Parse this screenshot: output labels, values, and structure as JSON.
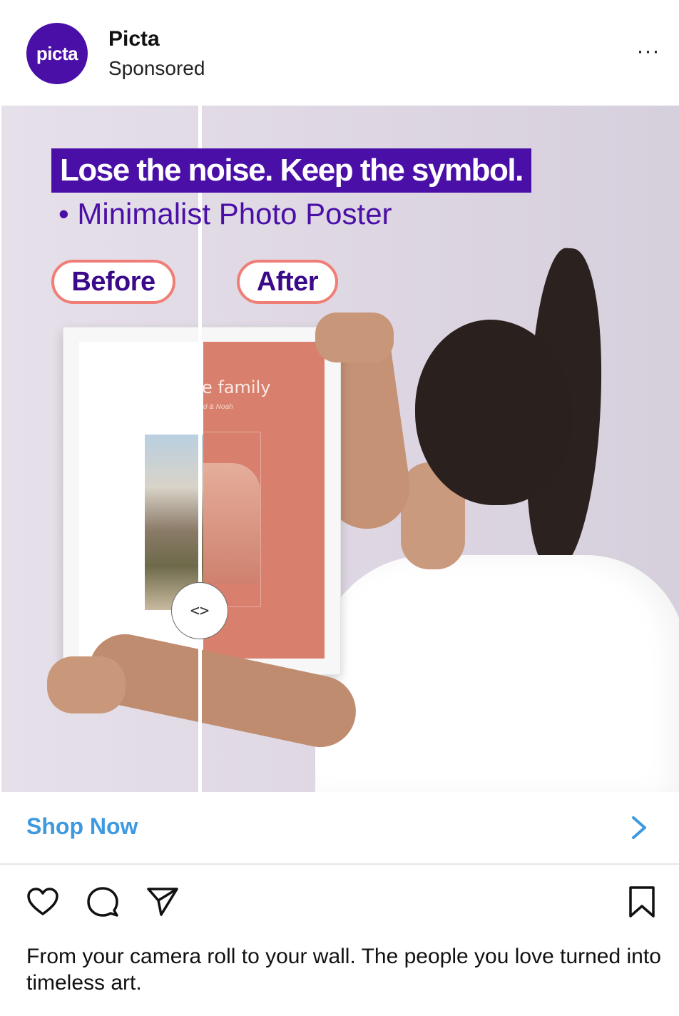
{
  "post": {
    "account_name": "Picta",
    "account_label": "Sponsored",
    "avatar_text": "picta",
    "more_label": "···"
  },
  "ad": {
    "headline": "Lose the noise. Keep the symbol.",
    "subheadline": "• Minimalist Photo Poster",
    "before_label": "Before",
    "after_label": "After",
    "poster_title": "e family",
    "poster_names": "d & Noah",
    "slider_handle": "<>"
  },
  "cta": {
    "label": "Shop Now",
    "accent": "#3d99e0"
  },
  "actions": {
    "like": "heart-icon",
    "comment": "comment-icon",
    "share": "send-icon",
    "save": "bookmark-icon"
  },
  "caption": "From your camera roll to your wall. The people you love turned into timeless art.",
  "colors": {
    "brand_purple": "#4a0fa6",
    "pill_border": "#f07e76",
    "poster_terracotta": "#d97f6d"
  }
}
